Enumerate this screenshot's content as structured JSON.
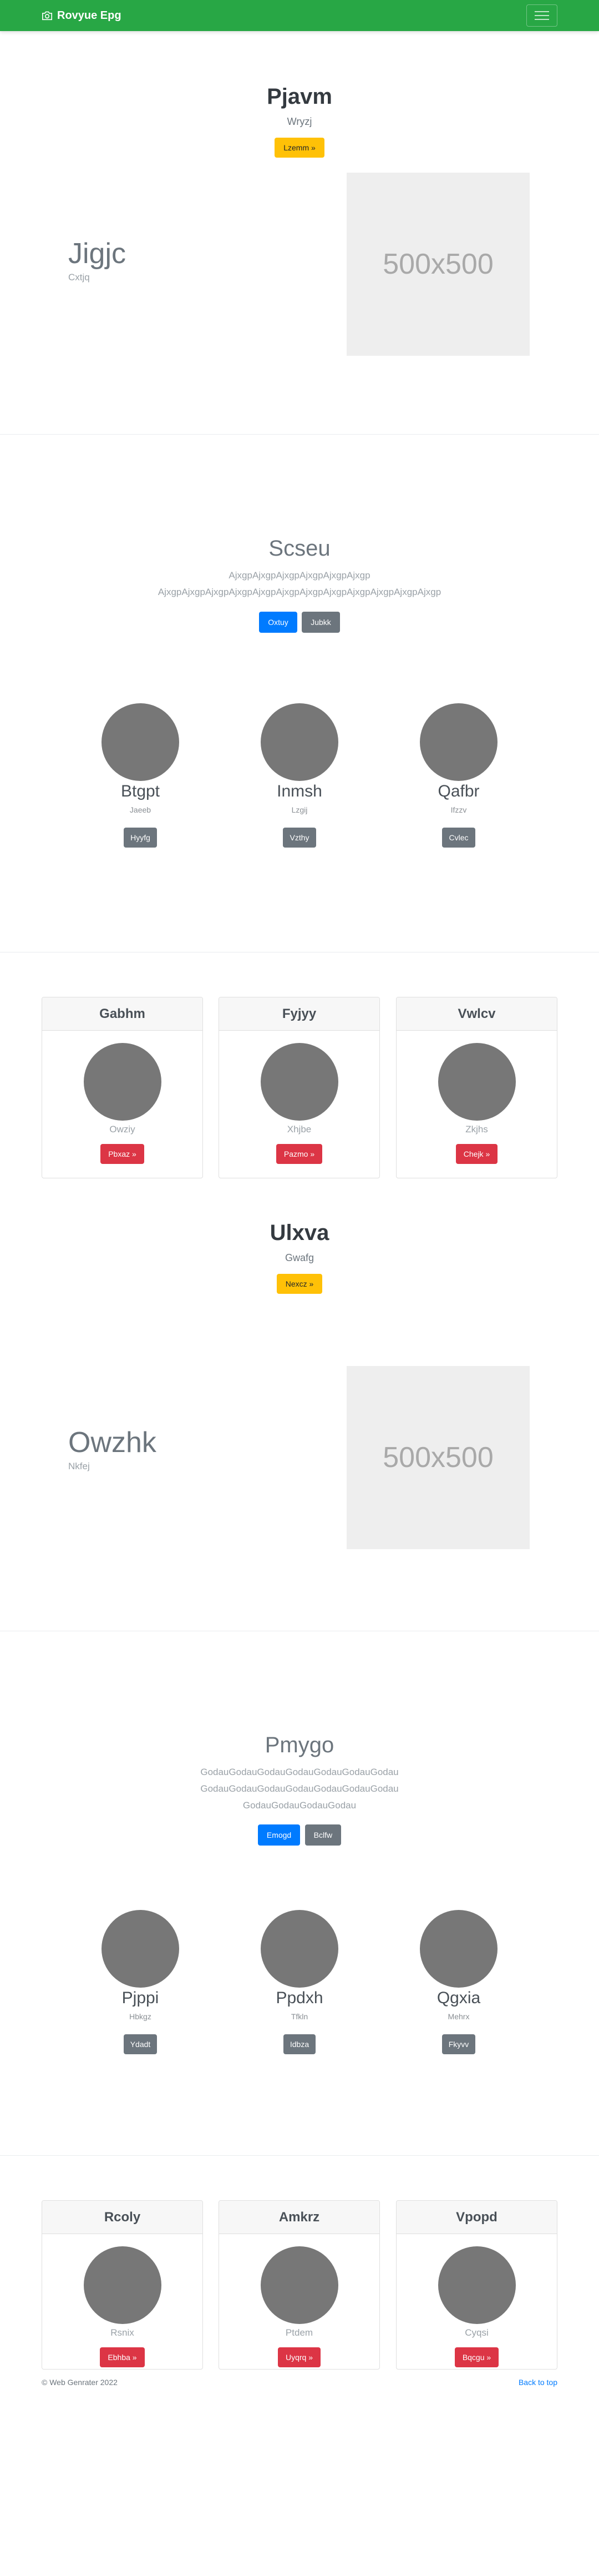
{
  "navbar": {
    "brand": "Rovyue Epg",
    "brand_icon": "camera-icon",
    "toggle_icon": "hamburger-menu-icon"
  },
  "hero1": {
    "title": "Pjavm",
    "subtitle": "Wryzj",
    "button": "Lzemm »"
  },
  "feature1": {
    "title": "Jigjc",
    "subtitle": "Cxtjq",
    "image_text": "500x500"
  },
  "lead1": {
    "title": "Scseu",
    "paragraph": "AjxgpAjxgpAjxgpAjxgpAjxgpAjxgp AjxgpAjxgpAjxgpAjxgpAjxgpAjxgpAjxgpAjxgpAjxgpAjxgpAjxgpAjxgp",
    "primary_button": "Oxtuy",
    "secondary_button": "Jubkk"
  },
  "trio1": [
    {
      "name": "Btgpt",
      "subtitle": "Jaeeb",
      "button": "Hyyfg"
    },
    {
      "name": "Inmsh",
      "subtitle": "Lzgij",
      "button": "Vzthy"
    },
    {
      "name": "Qafbr",
      "subtitle": "Ifzzv",
      "button": "Cvlec"
    }
  ],
  "cards1": [
    {
      "header": "Gabhm",
      "subtitle": "Owziy",
      "button": "Pbxaz »"
    },
    {
      "header": "Fyjyy",
      "subtitle": "Xhjbe",
      "button": "Pazmo »"
    },
    {
      "header": "Vwlcv",
      "subtitle": "Zkjhs",
      "button": "Chejk »"
    }
  ],
  "hero2": {
    "title": "Ulxva",
    "subtitle": "Gwafg",
    "button": "Nexcz »"
  },
  "feature2": {
    "title": "Owzhk",
    "subtitle": "Nkfej",
    "image_text": "500x500"
  },
  "lead2": {
    "title": "Pmygo",
    "paragraph": "GodauGodauGodauGodauGodauGodauGodauGodauGodauGodauGodauGodauGodauGodauGodauGodauGodauGodau",
    "primary_button": "Emogd",
    "secondary_button": "Bclfw"
  },
  "trio2": [
    {
      "name": "Pjppi",
      "subtitle": "Hbkgz",
      "button": "Ydadt"
    },
    {
      "name": "Ppdxh",
      "subtitle": "Tfkln",
      "button": "Idbza"
    },
    {
      "name": "Qgxia",
      "subtitle": "Mehrx",
      "button": "Fkyvv"
    }
  ],
  "cards2": [
    {
      "header": "Rcoly",
      "subtitle": "Rsnix",
      "button": "Ebhba »"
    },
    {
      "header": "Amkrz",
      "subtitle": "Ptdem",
      "button": "Uyqrq »"
    },
    {
      "header": "Vpopd",
      "subtitle": "Cyqsi",
      "button": "Bqcgu »"
    }
  ],
  "footer": {
    "copyright": "© Web Genrater 2022",
    "back_to_top": "Back to top"
  },
  "colors": {
    "navbar": "#28a745",
    "warning": "#ffc107",
    "primary": "#007bff",
    "secondary": "#6c757d",
    "danger": "#dc3545"
  }
}
